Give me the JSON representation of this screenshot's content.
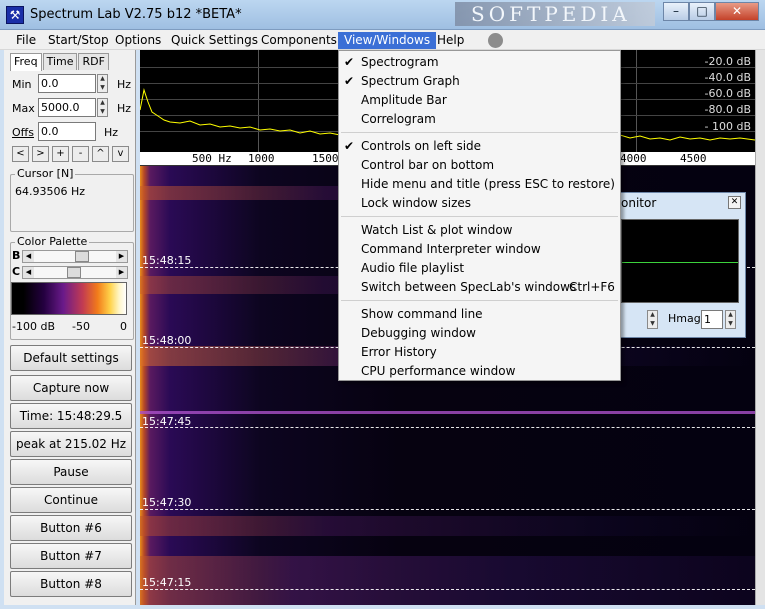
{
  "window": {
    "title": "Spectrum Lab V2.75 b12 *BETA*",
    "icon": "spectrum-app-icon",
    "watermark_text": "SOFTPEDIA",
    "controls": {
      "minimize": "–",
      "maximize": "□",
      "close": "✕"
    }
  },
  "menubar": {
    "items": [
      "File",
      "Start/Stop",
      "Options",
      "Quick Settings",
      "Components",
      "View/Windows",
      "Help"
    ],
    "active": "View/Windows"
  },
  "left_panel": {
    "tabs": [
      "Freq",
      "Time",
      "RDF"
    ],
    "active_tab": "Freq",
    "min_label": "Min",
    "min_value": "0.0",
    "max_label": "Max",
    "max_value": "5000.0",
    "offs_label": "Offs",
    "offs_value": "0.0",
    "unit": "Hz",
    "nav_buttons": [
      "<",
      ">",
      "+",
      "-",
      "^",
      "v"
    ],
    "cursor_group_title": "Cursor [N]",
    "cursor_value": "64.93506 Hz",
    "palette_group_title": "Color Palette",
    "brightness_label": "B",
    "contrast_label": "C",
    "palette_scale": [
      "-100 dB",
      "-50",
      "0"
    ],
    "buttons": [
      "Default settings",
      "Capture now",
      "Time:  15:48:29.5",
      "peak at 215.02 Hz",
      "Pause",
      "Continue",
      "Button #6",
      "Button #7",
      "Button #8"
    ]
  },
  "graph": {
    "db_labels": [
      "-20.0 dB",
      "-40.0 dB",
      "-60.0 dB",
      "-80.0 dB",
      "- 100 dB"
    ],
    "freq_labels": [
      "500 Hz",
      "1000",
      "1500",
      "4000",
      "4500"
    ],
    "trace_color": "#ffff00"
  },
  "waterfall": {
    "time_labels": [
      "15:48:15",
      "15:48:00",
      "15:47:45",
      "15:47:30",
      "15:47:15"
    ]
  },
  "monitor_window": {
    "title": "onitor",
    "hmag_label": "Hmag",
    "hmag_value": "1"
  },
  "dropdown": {
    "items": [
      {
        "label": "Spectrogram",
        "checked": true
      },
      {
        "label": "Spectrum Graph",
        "checked": true
      },
      {
        "label": "Amplitude Bar",
        "checked": false
      },
      {
        "label": "Correlogram",
        "checked": false
      },
      {
        "label": "Controls on left side",
        "checked": true
      },
      {
        "label": "Control bar on bottom",
        "checked": false
      },
      {
        "label": "Hide menu and title (press ESC to restore)",
        "checked": false
      },
      {
        "label": "Lock window sizes",
        "checked": false
      },
      {
        "label": "Watch List & plot window",
        "checked": false
      },
      {
        "label": "Command Interpreter window",
        "checked": false
      },
      {
        "label": "Audio file playlist",
        "checked": false
      },
      {
        "label": "Switch between SpecLab's windows",
        "checked": false,
        "shortcut": "Ctrl+F6"
      },
      {
        "label": "Show command line",
        "checked": false
      },
      {
        "label": "Debugging window",
        "checked": false
      },
      {
        "label": "Error History",
        "checked": false
      },
      {
        "label": "CPU performance window",
        "checked": false
      }
    ]
  }
}
